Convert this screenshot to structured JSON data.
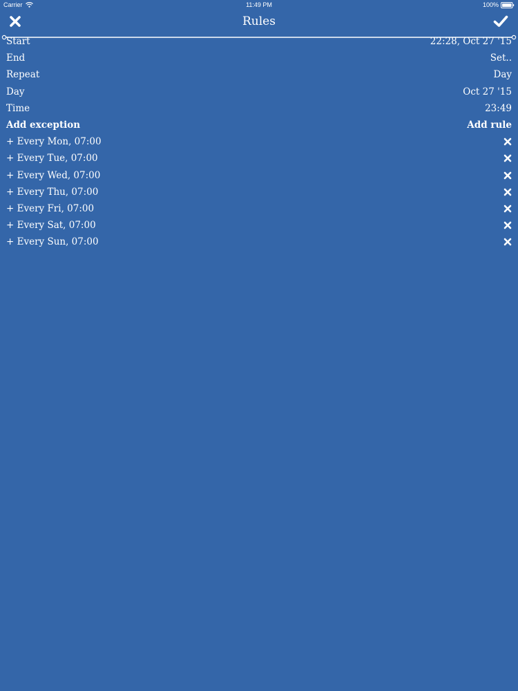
{
  "status_bar": {
    "carrier": "Carrier",
    "time": "11:49 PM",
    "battery": "100%",
    "battery_level": 1.0
  },
  "nav": {
    "title": "Rules",
    "close_icon": "close-icon",
    "confirm_icon": "checkmark-icon"
  },
  "settings": [
    {
      "label": "Start",
      "value": "22:28, Oct 27 '15"
    },
    {
      "label": "End",
      "value": "Set.."
    },
    {
      "label": "Repeat",
      "value": "Day"
    },
    {
      "label": "Day",
      "value": "Oct 27 '15"
    },
    {
      "label": "Time",
      "value": "23:49"
    }
  ],
  "actions": {
    "add_exception": "Add exception",
    "add_rule": "Add rule"
  },
  "rules": [
    {
      "text": "+ Every Mon, 07:00"
    },
    {
      "text": "+ Every Tue, 07:00"
    },
    {
      "text": "+ Every Wed, 07:00"
    },
    {
      "text": "+ Every Thu, 07:00"
    },
    {
      "text": "+ Every Fri, 07:00"
    },
    {
      "text": "+ Every Sat, 07:00"
    },
    {
      "text": "+ Every Sun, 07:00"
    }
  ],
  "colors": {
    "background": "#3466a9",
    "foreground": "#ffffff"
  }
}
